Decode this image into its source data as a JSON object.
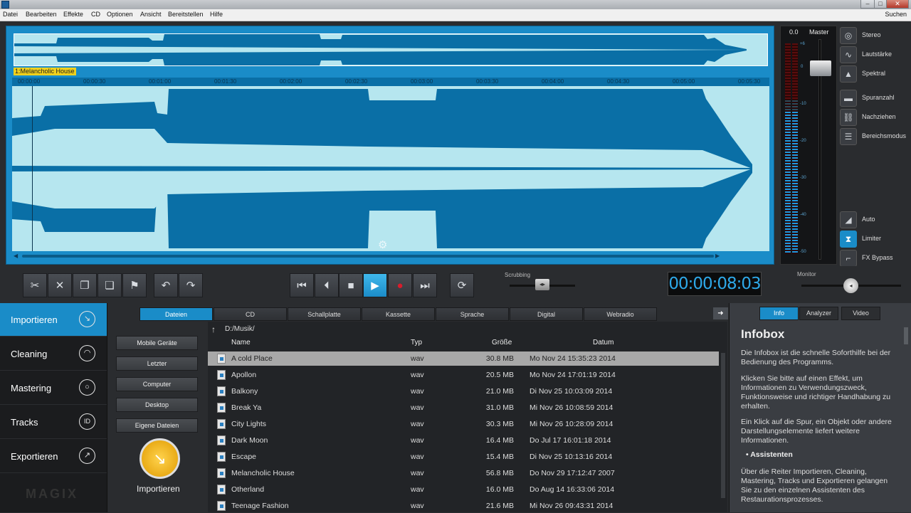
{
  "menu": {
    "items": [
      "Datei",
      "Bearbeiten",
      "Effekte",
      "CD",
      "Optionen",
      "Ansicht",
      "Bereitstellen",
      "Hilfe"
    ],
    "search": "Suchen"
  },
  "editor": {
    "track_label": "1:Melancholic House",
    "ruler_ticks": [
      "00:00:00",
      "00:00:30",
      "00:01:00",
      "00:01:30",
      "00:02:00",
      "00:02:30",
      "00:03:00",
      "00:03:30",
      "00:04:00",
      "00:04:30",
      "00:05:00",
      "00:05:30"
    ]
  },
  "mixer": {
    "value": "0.0",
    "master_label": "Master",
    "scale": [
      "+6",
      "0",
      "-10",
      "-20",
      "-30",
      "-40",
      "-50"
    ]
  },
  "side_buttons": [
    "Stereo",
    "Lautstärke",
    "Spektral",
    "Spuranzahl",
    "Nachziehen",
    "Bereichsmodus",
    "Auto",
    "Limiter",
    "FX Bypass"
  ],
  "transport": {
    "scrubbing_label": "Scrubbing",
    "timecode": "00:00:08:03",
    "monitor_label": "Monitor"
  },
  "nav": {
    "items": [
      "Importieren",
      "Cleaning",
      "Mastering",
      "Tracks",
      "Exportieren"
    ],
    "brand": "MAGIX"
  },
  "sources": {
    "buttons": [
      "Mobile Geräte",
      "Letzter",
      "Computer",
      "Desktop",
      "Eigene Dateien"
    ],
    "import_label": "Importieren"
  },
  "tabs": [
    "Dateien",
    "CD",
    "Schallplatte",
    "Kassette",
    "Sprache",
    "Digital",
    "Webradio"
  ],
  "files": {
    "path": "D:/Musik/",
    "columns": [
      "Name",
      "Typ",
      "Größe",
      "Datum"
    ],
    "rows": [
      {
        "name": "A cold Place",
        "typ": "wav",
        "size": "30.8 MB",
        "date": "Mo Nov 24 15:35:23 2014"
      },
      {
        "name": "Apollon",
        "typ": "wav",
        "size": "20.5 MB",
        "date": "Mo Nov 24 17:01:19 2014"
      },
      {
        "name": "Balkony",
        "typ": "wav",
        "size": "21.0 MB",
        "date": "Di Nov 25 10:03:09 2014"
      },
      {
        "name": "Break Ya",
        "typ": "wav",
        "size": "31.0 MB",
        "date": "Mi Nov 26 10:08:59 2014"
      },
      {
        "name": "City Lights",
        "typ": "wav",
        "size": "30.3 MB",
        "date": "Mi Nov 26 10:28:09 2014"
      },
      {
        "name": "Dark Moon",
        "typ": "wav",
        "size": "16.4 MB",
        "date": "Do Jul 17 16:01:18 2014"
      },
      {
        "name": "Escape",
        "typ": "wav",
        "size": "15.4 MB",
        "date": "Di Nov 25 10:13:16 2014"
      },
      {
        "name": "Melancholic House",
        "typ": "wav",
        "size": "56.8 MB",
        "date": "Do Nov 29 17:12:47 2007"
      },
      {
        "name": "Otherland",
        "typ": "wav",
        "size": "16.0 MB",
        "date": "Do Aug 14 16:33:06 2014"
      },
      {
        "name": "Teenage Fashion",
        "typ": "wav",
        "size": "21.6 MB",
        "date": "Mi Nov 26 09:43:31 2014"
      }
    ]
  },
  "info": {
    "tabs": [
      "Info",
      "Analyzer",
      "Video"
    ],
    "title": "Infobox",
    "p1": "Die Infobox ist die schnelle Soforthilfe bei der Bedienung des Programms.",
    "p2": "Klicken Sie bitte auf einen Effekt, um Informationen zu Verwendungszweck, Funktionsweise und richtiger Handhabung zu erhalten.",
    "p3": "Ein Klick auf die Spur, ein Objekt oder andere Darstellungselemente liefert weitere Informationen.",
    "sub": "Assistenten",
    "p4": "Über die Reiter Importieren, Cleaning, Mastering, Tracks und Exportieren gelangen Sie zu den einzelnen Assistenten des Restaurationsprozesses."
  }
}
